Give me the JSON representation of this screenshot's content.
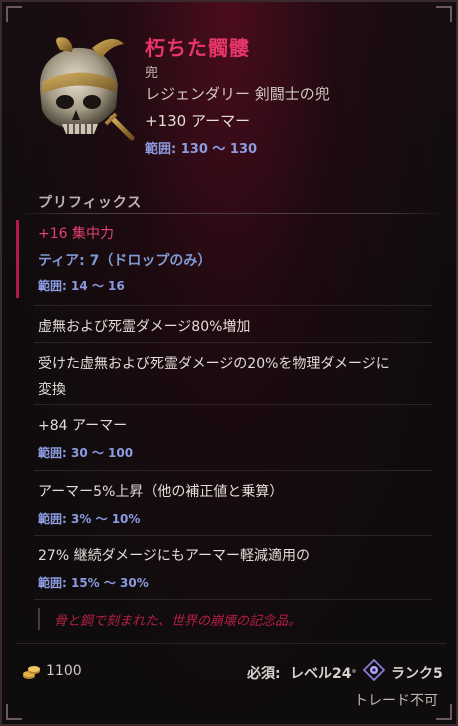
{
  "item": {
    "name": "朽ちた髑髏",
    "slot": "兜",
    "rarity_type": "レジェンダリー 剣闘士の兜",
    "armor": "+130 アーマー",
    "armor_range": "範囲: 130 〜 130"
  },
  "prefix": {
    "heading": "プリフィックス",
    "implicit_value": "+16 集中力",
    "implicit_tier": "ティア: 7（ドロップのみ）",
    "implicit_range": "範囲: 14 〜 16"
  },
  "affixes": [
    {
      "line1": "虚無および死霊ダメージ80%増加"
    },
    {
      "line1": "受けた虚無および死霊ダメージの20%を物理ダメージに",
      "line2": "変換"
    },
    {
      "line1": "+84 アーマー",
      "range": "範囲: 30 〜 100"
    },
    {
      "line1": "アーマー5%上昇（他の補正値と乗算）",
      "range": "範囲: 3% 〜 10%"
    },
    {
      "line1": "27% 継続ダメージにもアーマー軽減適用の",
      "range": "範囲: 15% 〜 30%"
    }
  ],
  "flavor": "骨と鋼で刻まれた、世界の崩壊の記念品。",
  "footer": {
    "gold": "1100",
    "requirement_label": "必須:",
    "requirement_value": "レベル24",
    "rank": "ランク5",
    "trade": "トレード不可"
  },
  "colors": {
    "legendary_name": "#e8356a",
    "range_text": "#8c9be0",
    "implicit": "#e44271",
    "flavor": "#b61f47"
  }
}
